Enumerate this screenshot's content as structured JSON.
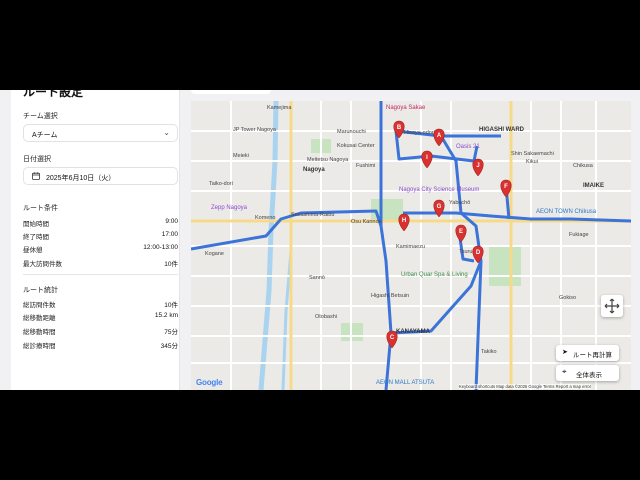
{
  "sidebar": {
    "title": "ルート設定",
    "team_label": "チーム選択",
    "team_value": "Aチーム",
    "date_label": "日付選択",
    "date_value": "2025年6月10日（火）",
    "conditions_title": "ルート条件",
    "conditions": [
      {
        "key": "開始時間",
        "value": "9:00"
      },
      {
        "key": "終了時間",
        "value": "17:00"
      },
      {
        "key": "昼休憩",
        "value": "12:00-13:00"
      },
      {
        "key": "最大訪問件数",
        "value": "10件"
      }
    ],
    "stats_title": "ルート統計",
    "stats": [
      {
        "key": "総訪問件数",
        "value": "10件"
      },
      {
        "key": "総移動距離",
        "value": "15.2 km"
      },
      {
        "key": "総移動時間",
        "value": "75分"
      },
      {
        "key": "総診療時間",
        "value": "345分"
      }
    ]
  },
  "map": {
    "pins": [
      {
        "label": "A"
      },
      {
        "label": "B"
      },
      {
        "label": "C"
      },
      {
        "label": "D"
      },
      {
        "label": "E"
      },
      {
        "label": "F"
      },
      {
        "label": "G"
      },
      {
        "label": "H"
      },
      {
        "label": "I"
      },
      {
        "label": "J"
      }
    ],
    "place_labels": {
      "kamejima": "Kamejima",
      "nagoya_sakae": "Nagoya Sakae",
      "jp_tower": "JP Tower Nagoya",
      "marunouchi": "Marunouchi",
      "hisaya_odori": "Hisaya-odori",
      "higashi_ward": "HIGASHI WARD",
      "kokusai_center": "Kokusai Center",
      "oasis21": "Oasis 21",
      "shin_sakaemachi": "Shin Sakaemachi",
      "meieki": "Meieki",
      "meitetsu": "Meitetsu Nagoya",
      "nagoya": "Nagoya",
      "fushimi": "Fushimi",
      "kikui": "Kikui",
      "chikusa": "Chikusa",
      "taiko_dori": "Taiko-dori",
      "imaike": "IMAIKE",
      "science_museum": "Nagoya City Science Museum",
      "zepp": "Zepp Nagoya",
      "yabacho": "Yabachō",
      "sasashima": "Sasashima-Raibu",
      "osu_kannon": "Osu Kannon",
      "aeon_chikusa": "AEON TOWN Chikusa",
      "komeno": "Komeno",
      "fukiage": "Fukiage",
      "kamimaezu": "Kamimaezu",
      "kogane": "Kogane",
      "tsurumai": "Tsurumai",
      "urban_quar": "Urban Quar Spa & Living",
      "sanno": "Sannō",
      "higashi_betsuin": "Higashi Betsuin",
      "gokiso": "Gokiso",
      "otobashi": "Otobashi",
      "kanayama": "KANAYAMA",
      "aeon_atsuta": "AEON MALL ATSUTA",
      "takiko": "Takiko"
    },
    "controls": {
      "recalc": "ルート再計算",
      "show_all": "全体表示"
    },
    "google_logo": "Google",
    "attribution": "Keyboard shortcuts   Map data ©2025 Google   Terms   Report a map error"
  },
  "colors": {
    "route": "#3b73d9",
    "pin": "#d93030",
    "park": "#c8e3c0",
    "water": "#a9d3ef"
  }
}
